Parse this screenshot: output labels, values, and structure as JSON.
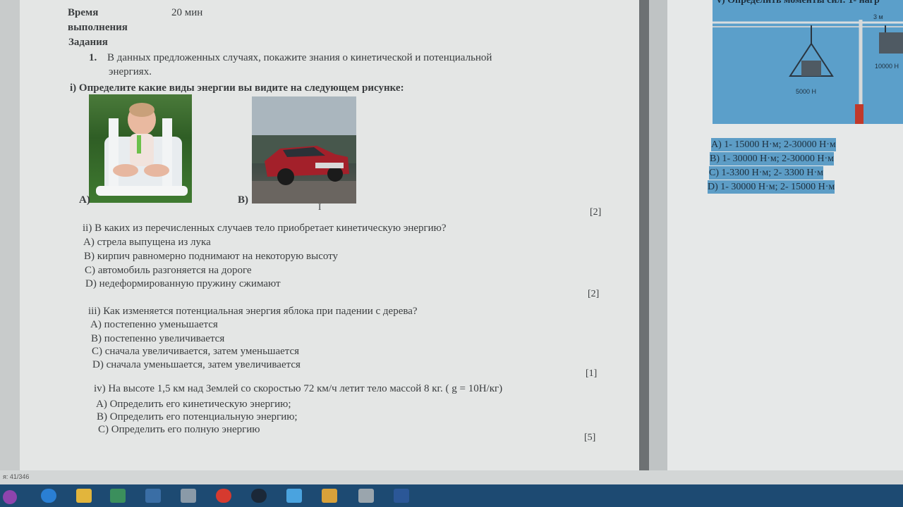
{
  "header": {
    "time_label": "Время",
    "time_value": "20 мин",
    "time_label_2": "выполнения",
    "tasks_label": "Задания"
  },
  "task1": {
    "number": "1.",
    "text_line1": "В данных предложенных случаях, покажите знания о кинетической и потенциальной",
    "text_line2": "энергиях."
  },
  "q1": {
    "text": "i) Определите какие виды энергии вы видите на следующем рисунке:",
    "label_a": "A)",
    "label_b": "B)",
    "small_mark": "I",
    "score": "[2]"
  },
  "q2": {
    "text": "ii)  В каких из перечисленных случаев тело  приобретает кинетическую энергию?",
    "options": [
      "A) стрела выпущена из лука",
      "B) кирпич равномерно поднимают на некоторую высоту",
      "C) автомобиль разгоняется на дороге",
      "D) недеформированную пружину сжимают"
    ],
    "score": "[2]"
  },
  "q3": {
    "text": "iii) Как изменяется потенциальная энергия  яблока при падении с дерева?",
    "options": [
      "A) постепенно уменьшается",
      "B) постепенно увеличивается",
      "C) сначала увеличивается, затем уменьшается",
      "D) сначала уменьшается, затем увеличивается"
    ],
    "score": "[1]"
  },
  "q4": {
    "text": "iv) На высоте 1,5 км  над  Землей со скоростью  72 км/ч летит тело массой  8 кг. ( g = 10Н/кг)",
    "options": [
      "A) Определить его кинетическую энергию;",
      "B) Определить его потенциальную энергию;",
      "C) Определить его полную энергию"
    ],
    "score": "[5]"
  },
  "right_page": {
    "question_partial": "v) Определить моменты сил: 1- нагр",
    "figure_labels": {
      "dist": "3 м",
      "load_left": "5000 Н",
      "load_right": "10000 Н"
    },
    "answers": [
      "A) 1- 15000 Н·м;   2-30000 Н·м",
      "B) 1- 30000 Н·м;   2-30000 Н·м",
      "C) 1-3300 Н·м;       2- 3300 Н·м",
      "D) 1- 30000 Н·м;  2- 15000 Н·м"
    ]
  },
  "status": {
    "page_counter": "я: 41/346"
  },
  "colors": {
    "page": "#e4e6e5",
    "taskbar": "#1d4a72",
    "figure_blue": "#5b9fca"
  }
}
